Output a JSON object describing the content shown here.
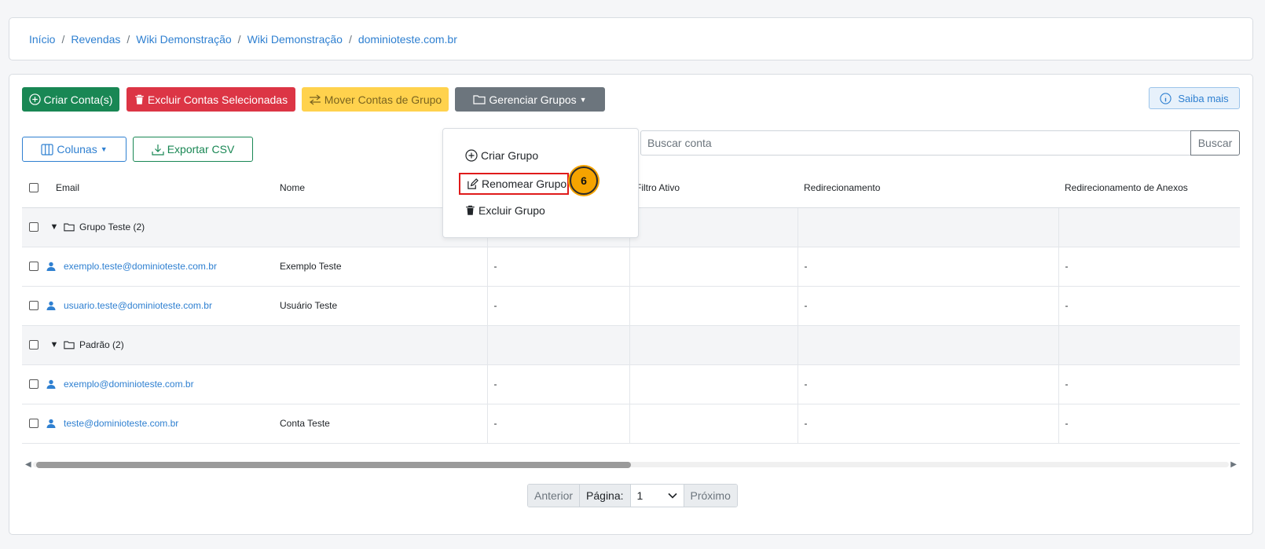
{
  "breadcrumb": [
    "Início",
    "Revendas",
    "Wiki Demonstração",
    "Wiki Demonstração",
    "dominioteste.com.br"
  ],
  "breadcrumb_separator": "/",
  "toolbar": {
    "create": "Criar Conta(s)",
    "delete": "Excluir Contas Selecionadas",
    "move": "Mover Contas de Grupo",
    "groups": "Gerenciar Grupos",
    "info": "Saiba mais",
    "columns": "Colunas",
    "export": "Exportar CSV"
  },
  "search": {
    "placeholder": "Buscar conta",
    "button": "Buscar"
  },
  "dropdown": {
    "items": [
      "Criar Grupo",
      "Renomear Grupo",
      "Excluir Grupo"
    ],
    "step_badge": "6"
  },
  "table": {
    "headers": [
      "Email",
      "Nome",
      "",
      "Filtro Ativo",
      "Redirecionamento",
      "Redirecionamento de Anexos"
    ],
    "groups": [
      {
        "label": "Grupo Teste (2)",
        "rows": [
          {
            "email": "exemplo.teste@dominioteste.com.br",
            "nome": "Exemplo Teste",
            "c3": "-",
            "filtro": "",
            "redir": "-",
            "anexos": "-"
          },
          {
            "email": "usuario.teste@dominioteste.com.br",
            "nome": "Usuário Teste",
            "c3": "-",
            "filtro": "",
            "redir": "-",
            "anexos": "-"
          }
        ]
      },
      {
        "label": "Padrão (2)",
        "rows": [
          {
            "email": "exemplo@dominioteste.com.br",
            "nome": "",
            "c3": "-",
            "filtro": "",
            "redir": "-",
            "anexos": "-"
          },
          {
            "email": "teste@dominioteste.com.br",
            "nome": "Conta Teste",
            "c3": "-",
            "filtro": "",
            "redir": "-",
            "anexos": "-"
          }
        ]
      }
    ]
  },
  "pager": {
    "prev": "Anterior",
    "page_label": "Página:",
    "page_value": "1",
    "next": "Próximo"
  },
  "colors": {
    "primary": "#2f80d1",
    "success": "#198754",
    "danger": "#dc3545",
    "warning": "#ffd24d",
    "secondary": "#6c757d",
    "highlight": "#e01b1b",
    "badge": "#f5a300"
  }
}
